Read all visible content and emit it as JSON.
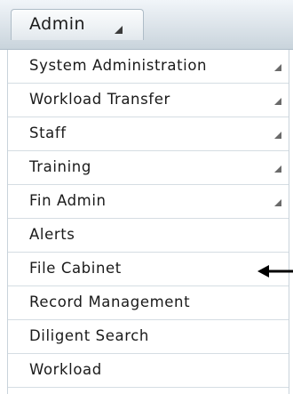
{
  "menubar": {
    "tab_label": "Admin"
  },
  "menu": {
    "items": [
      {
        "label": "System Administration"
      },
      {
        "label": "Workload Transfer"
      },
      {
        "label": "Staff"
      },
      {
        "label": "Training"
      },
      {
        "label": "Fin Admin"
      },
      {
        "label": "Alerts"
      },
      {
        "label": "File Cabinet"
      },
      {
        "label": "Record Management"
      },
      {
        "label": "Diligent Search"
      },
      {
        "label": "Workload"
      }
    ]
  },
  "icons": {
    "submenu": "submenu-triangle-icon",
    "pointer": "left-arrow-icon"
  },
  "colors": {
    "menubar_top": "#f1f5f9",
    "menubar_bottom": "#c9d4dc",
    "separator": "#d5dde3",
    "text": "#1a1a1a",
    "submenu_icon": "#6a6a6a",
    "pointer_arrow": "#000000"
  }
}
